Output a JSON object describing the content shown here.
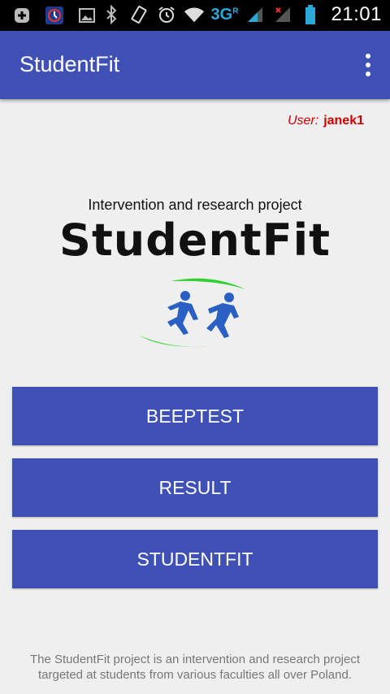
{
  "status_bar": {
    "network": "3G",
    "network_superscript": "R",
    "time": "21:01"
  },
  "app_bar": {
    "title": "StudentFit"
  },
  "user": {
    "label": "User:",
    "name": "janek1"
  },
  "header": {
    "tagline": "Intervention and research project",
    "logo_text": "StudentFit"
  },
  "buttons": {
    "beeptest": "BEEPTEST",
    "result": "RESULT",
    "studentfit": "STUDENTFIT"
  },
  "footer": {
    "text": "The StudentFit project is an intervention and research project targeted at students from various faculties all over Poland."
  },
  "colors": {
    "primary": "#3f51b5",
    "user_text": "#cc0000",
    "logo_green": "#2fd02f",
    "logo_blue": "#2a5fc4"
  }
}
